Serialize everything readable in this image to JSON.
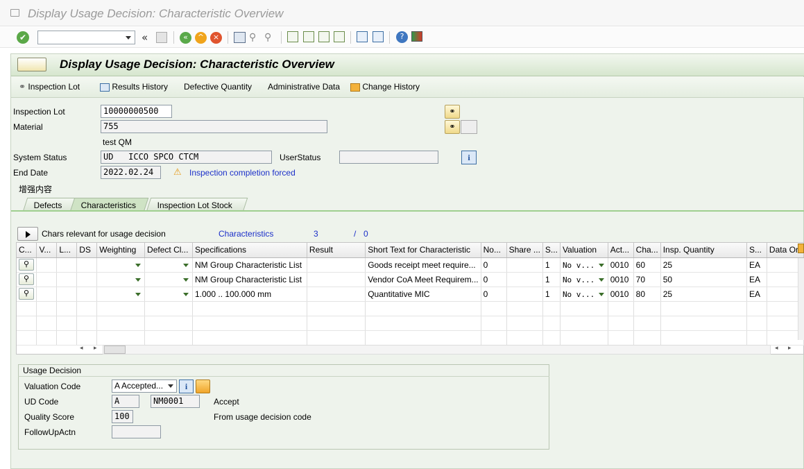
{
  "window": {
    "title": "Display Usage Decision: Characteristic Overview"
  },
  "page": {
    "title": "Display Usage Decision: Characteristic Overview"
  },
  "app_toolbar": {
    "inspection_lot": "Inspection Lot",
    "results_history": "Results History",
    "defective_quantity": "Defective Quantity",
    "administrative_data": "Administrative Data",
    "change_history": "Change History"
  },
  "header": {
    "inspection_lot_label": "Inspection Lot",
    "inspection_lot_value": "10000000500",
    "material_label": "Material",
    "material_value": "755",
    "material_desc": "test QM",
    "system_status_label": "System Status",
    "system_status_value": "UD   ICCO SPCO CTCM",
    "user_status_label": "UserStatus",
    "user_status_value": "",
    "end_date_label": "End Date",
    "end_date_value": "2022.02.24",
    "completion_note": "Inspection completion forced",
    "enhancement": "增强内容"
  },
  "tabs": [
    "Defects",
    "Characteristics",
    "Inspection Lot Stock"
  ],
  "chars_bar": {
    "label": "Chars relevant for usage decision",
    "link": "Characteristics",
    "count": "3",
    "slash": "/",
    "second": "0"
  },
  "grid": {
    "columns": [
      "C...",
      "V...",
      "L...",
      "DS",
      "Weighting",
      "Defect Cl...",
      "Specifications",
      "Result",
      "Short Text for Characteristic",
      "No...",
      "Share ...",
      "S...",
      "Valuation",
      "Act...",
      "Cha...",
      "Insp. Quantity",
      "S...",
      "Data Ori"
    ],
    "rows": [
      {
        "spec": "NM Group Characteristic List",
        "short": "Goods receipt meet require...",
        "no": "0",
        "s": "1",
        "valuation": "No v...",
        "act": "0010",
        "cha": "60",
        "qty": "25",
        "unit": "EA"
      },
      {
        "spec": "NM Group Characteristic List",
        "short": "Vendor CoA Meet Requirem...",
        "no": "0",
        "s": "1",
        "valuation": "No v...",
        "act": "0010",
        "cha": "70",
        "qty": "50",
        "unit": "EA"
      },
      {
        "spec": "1.000 .. 100.000 mm",
        "short": "Quantitative MIC",
        "no": "0",
        "s": "1",
        "valuation": "No v...",
        "act": "0010",
        "cha": "80",
        "qty": "25",
        "unit": "EA"
      }
    ]
  },
  "usage_decision": {
    "title": "Usage Decision",
    "valuation_code_label": "Valuation Code",
    "valuation_code_value": "A Accepted...",
    "ud_code_label": "UD Code",
    "ud_code_value": "A",
    "ud_code_group": "NM0001",
    "ud_code_text": "Accept",
    "quality_score_label": "Quality Score",
    "quality_score_value": "100",
    "quality_score_text": "From usage decision code",
    "followup_label": "FollowUpActn",
    "followup_value": ""
  },
  "icons": [
    "check-icon",
    "back-icon",
    "save-icon",
    "exit-icon",
    "cancel-icon",
    "print-icon",
    "find-icon",
    "find-next-icon",
    "first-page-icon",
    "prev-page-icon",
    "next-page-icon",
    "last-page-icon",
    "new-session-icon",
    "shortcut-icon",
    "help-icon",
    "customize-icon"
  ]
}
